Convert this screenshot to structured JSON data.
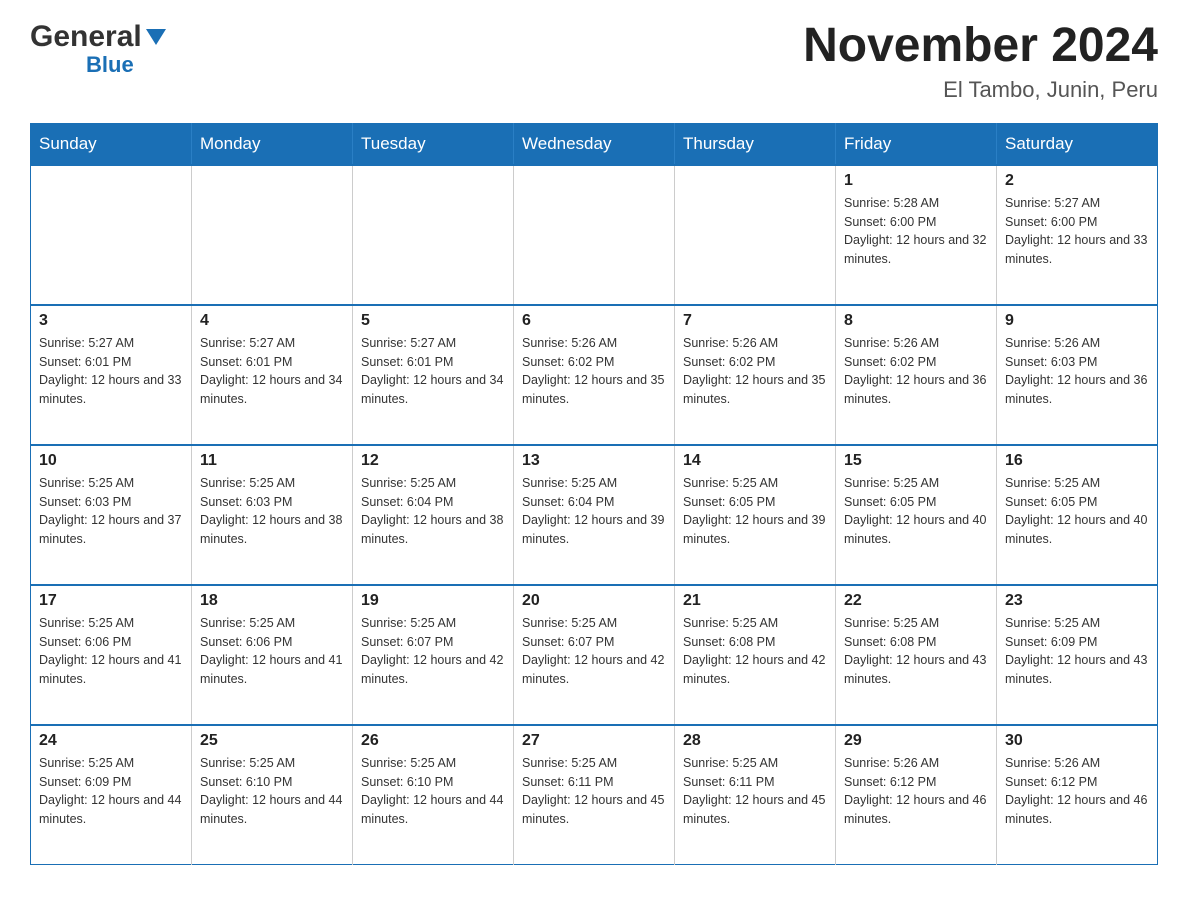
{
  "logo": {
    "general": "General",
    "blue": "Blue"
  },
  "title": "November 2024",
  "subtitle": "El Tambo, Junin, Peru",
  "days_of_week": [
    "Sunday",
    "Monday",
    "Tuesday",
    "Wednesday",
    "Thursday",
    "Friday",
    "Saturday"
  ],
  "weeks": [
    [
      {
        "day": "",
        "sunrise": "",
        "sunset": "",
        "daylight": ""
      },
      {
        "day": "",
        "sunrise": "",
        "sunset": "",
        "daylight": ""
      },
      {
        "day": "",
        "sunrise": "",
        "sunset": "",
        "daylight": ""
      },
      {
        "day": "",
        "sunrise": "",
        "sunset": "",
        "daylight": ""
      },
      {
        "day": "",
        "sunrise": "",
        "sunset": "",
        "daylight": ""
      },
      {
        "day": "1",
        "sunrise": "Sunrise: 5:28 AM",
        "sunset": "Sunset: 6:00 PM",
        "daylight": "Daylight: 12 hours and 32 minutes."
      },
      {
        "day": "2",
        "sunrise": "Sunrise: 5:27 AM",
        "sunset": "Sunset: 6:00 PM",
        "daylight": "Daylight: 12 hours and 33 minutes."
      }
    ],
    [
      {
        "day": "3",
        "sunrise": "Sunrise: 5:27 AM",
        "sunset": "Sunset: 6:01 PM",
        "daylight": "Daylight: 12 hours and 33 minutes."
      },
      {
        "day": "4",
        "sunrise": "Sunrise: 5:27 AM",
        "sunset": "Sunset: 6:01 PM",
        "daylight": "Daylight: 12 hours and 34 minutes."
      },
      {
        "day": "5",
        "sunrise": "Sunrise: 5:27 AM",
        "sunset": "Sunset: 6:01 PM",
        "daylight": "Daylight: 12 hours and 34 minutes."
      },
      {
        "day": "6",
        "sunrise": "Sunrise: 5:26 AM",
        "sunset": "Sunset: 6:02 PM",
        "daylight": "Daylight: 12 hours and 35 minutes."
      },
      {
        "day": "7",
        "sunrise": "Sunrise: 5:26 AM",
        "sunset": "Sunset: 6:02 PM",
        "daylight": "Daylight: 12 hours and 35 minutes."
      },
      {
        "day": "8",
        "sunrise": "Sunrise: 5:26 AM",
        "sunset": "Sunset: 6:02 PM",
        "daylight": "Daylight: 12 hours and 36 minutes."
      },
      {
        "day": "9",
        "sunrise": "Sunrise: 5:26 AM",
        "sunset": "Sunset: 6:03 PM",
        "daylight": "Daylight: 12 hours and 36 minutes."
      }
    ],
    [
      {
        "day": "10",
        "sunrise": "Sunrise: 5:25 AM",
        "sunset": "Sunset: 6:03 PM",
        "daylight": "Daylight: 12 hours and 37 minutes."
      },
      {
        "day": "11",
        "sunrise": "Sunrise: 5:25 AM",
        "sunset": "Sunset: 6:03 PM",
        "daylight": "Daylight: 12 hours and 38 minutes."
      },
      {
        "day": "12",
        "sunrise": "Sunrise: 5:25 AM",
        "sunset": "Sunset: 6:04 PM",
        "daylight": "Daylight: 12 hours and 38 minutes."
      },
      {
        "day": "13",
        "sunrise": "Sunrise: 5:25 AM",
        "sunset": "Sunset: 6:04 PM",
        "daylight": "Daylight: 12 hours and 39 minutes."
      },
      {
        "day": "14",
        "sunrise": "Sunrise: 5:25 AM",
        "sunset": "Sunset: 6:05 PM",
        "daylight": "Daylight: 12 hours and 39 minutes."
      },
      {
        "day": "15",
        "sunrise": "Sunrise: 5:25 AM",
        "sunset": "Sunset: 6:05 PM",
        "daylight": "Daylight: 12 hours and 40 minutes."
      },
      {
        "day": "16",
        "sunrise": "Sunrise: 5:25 AM",
        "sunset": "Sunset: 6:05 PM",
        "daylight": "Daylight: 12 hours and 40 minutes."
      }
    ],
    [
      {
        "day": "17",
        "sunrise": "Sunrise: 5:25 AM",
        "sunset": "Sunset: 6:06 PM",
        "daylight": "Daylight: 12 hours and 41 minutes."
      },
      {
        "day": "18",
        "sunrise": "Sunrise: 5:25 AM",
        "sunset": "Sunset: 6:06 PM",
        "daylight": "Daylight: 12 hours and 41 minutes."
      },
      {
        "day": "19",
        "sunrise": "Sunrise: 5:25 AM",
        "sunset": "Sunset: 6:07 PM",
        "daylight": "Daylight: 12 hours and 42 minutes."
      },
      {
        "day": "20",
        "sunrise": "Sunrise: 5:25 AM",
        "sunset": "Sunset: 6:07 PM",
        "daylight": "Daylight: 12 hours and 42 minutes."
      },
      {
        "day": "21",
        "sunrise": "Sunrise: 5:25 AM",
        "sunset": "Sunset: 6:08 PM",
        "daylight": "Daylight: 12 hours and 42 minutes."
      },
      {
        "day": "22",
        "sunrise": "Sunrise: 5:25 AM",
        "sunset": "Sunset: 6:08 PM",
        "daylight": "Daylight: 12 hours and 43 minutes."
      },
      {
        "day": "23",
        "sunrise": "Sunrise: 5:25 AM",
        "sunset": "Sunset: 6:09 PM",
        "daylight": "Daylight: 12 hours and 43 minutes."
      }
    ],
    [
      {
        "day": "24",
        "sunrise": "Sunrise: 5:25 AM",
        "sunset": "Sunset: 6:09 PM",
        "daylight": "Daylight: 12 hours and 44 minutes."
      },
      {
        "day": "25",
        "sunrise": "Sunrise: 5:25 AM",
        "sunset": "Sunset: 6:10 PM",
        "daylight": "Daylight: 12 hours and 44 minutes."
      },
      {
        "day": "26",
        "sunrise": "Sunrise: 5:25 AM",
        "sunset": "Sunset: 6:10 PM",
        "daylight": "Daylight: 12 hours and 44 minutes."
      },
      {
        "day": "27",
        "sunrise": "Sunrise: 5:25 AM",
        "sunset": "Sunset: 6:11 PM",
        "daylight": "Daylight: 12 hours and 45 minutes."
      },
      {
        "day": "28",
        "sunrise": "Sunrise: 5:25 AM",
        "sunset": "Sunset: 6:11 PM",
        "daylight": "Daylight: 12 hours and 45 minutes."
      },
      {
        "day": "29",
        "sunrise": "Sunrise: 5:26 AM",
        "sunset": "Sunset: 6:12 PM",
        "daylight": "Daylight: 12 hours and 46 minutes."
      },
      {
        "day": "30",
        "sunrise": "Sunrise: 5:26 AM",
        "sunset": "Sunset: 6:12 PM",
        "daylight": "Daylight: 12 hours and 46 minutes."
      }
    ]
  ]
}
